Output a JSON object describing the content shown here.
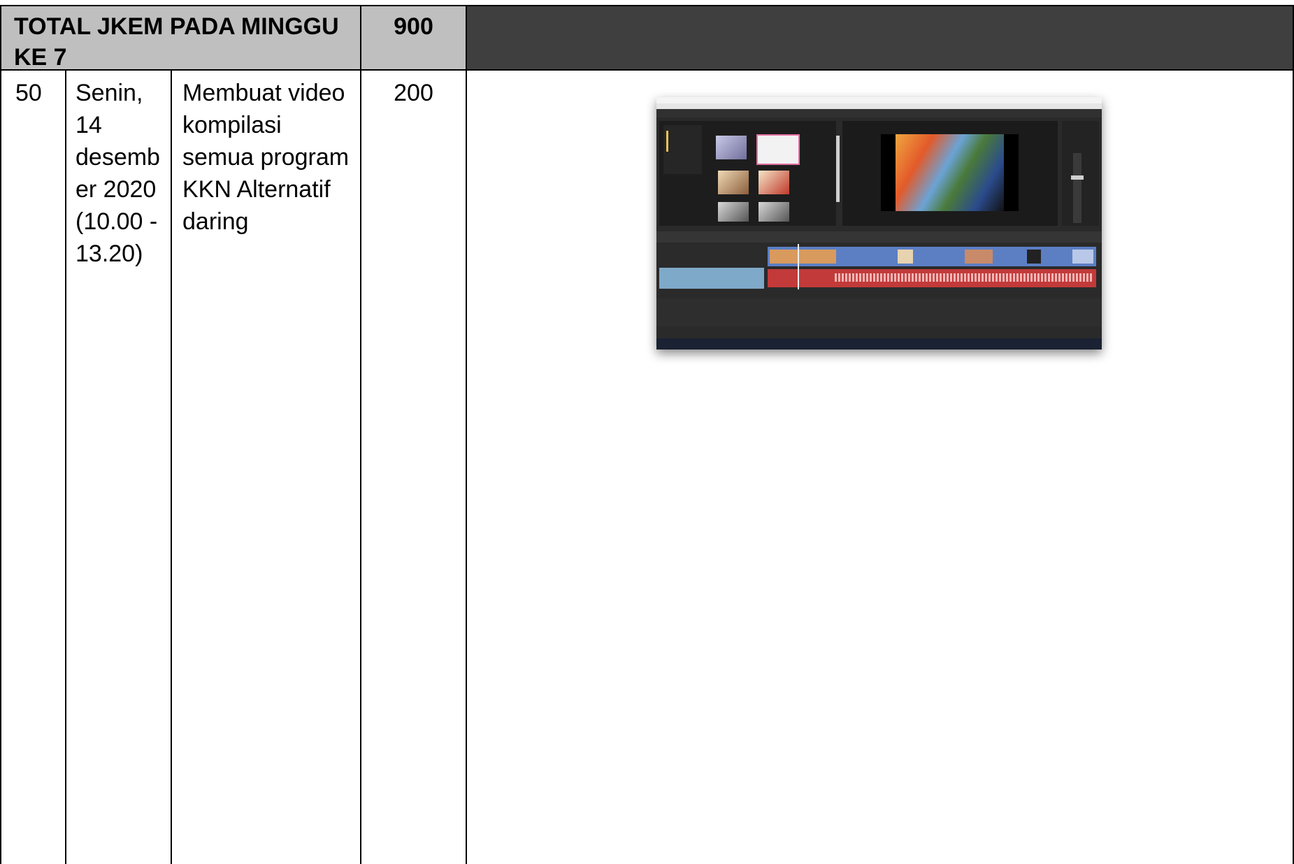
{
  "header": {
    "total_label_line1": "TOTAL JKEM PADA MINGGU",
    "total_label_line2": "KE 7",
    "total_value": "900"
  },
  "row": {
    "number": "50",
    "date_lines": [
      "Senin,",
      "14",
      "desemb",
      "er 2020",
      "(10.00 -",
      "13.20)"
    ],
    "activity_lines": [
      "Membuat video",
      "kompilasi",
      "semua program",
      "KKN Alternatif",
      "daring"
    ],
    "jkem": "200"
  },
  "screenshot": {
    "subject": "video-editor-screenshot"
  },
  "colors": {
    "header_gray": "#bfbfbf",
    "header_dark": "#3f3f3f",
    "border": "#000000"
  }
}
